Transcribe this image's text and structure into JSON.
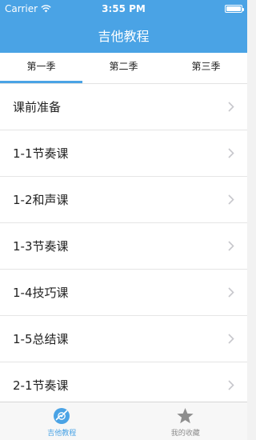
{
  "status_bar": {
    "carrier": "Carrier",
    "time": "3:55 PM"
  },
  "nav": {
    "title": "吉他教程"
  },
  "season_tabs": [
    {
      "label": "第一季",
      "active": true
    },
    {
      "label": "第二季",
      "active": false
    },
    {
      "label": "第三季",
      "active": false
    }
  ],
  "lessons": [
    {
      "label": "课前准备"
    },
    {
      "label": "1-1节奏课"
    },
    {
      "label": "1-2和声课"
    },
    {
      "label": "1-3节奏课"
    },
    {
      "label": "1-4技巧课"
    },
    {
      "label": "1-5总结课"
    },
    {
      "label": "2-1节奏课"
    }
  ],
  "tabbar": [
    {
      "label": "吉他教程",
      "icon": "guitar-disc-icon",
      "active": true
    },
    {
      "label": "我的收藏",
      "icon": "star-icon",
      "active": false
    }
  ],
  "colors": {
    "accent": "#4aa3e5",
    "inactive": "#8e8e8e"
  }
}
